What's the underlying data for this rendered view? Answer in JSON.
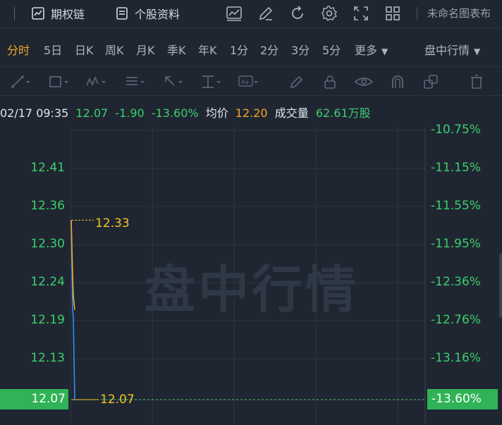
{
  "toolbar": {
    "options_chain_label": "期权链",
    "stock_info_label": "个股资料",
    "chart_name": "未命名图表布"
  },
  "periods": {
    "items": [
      "分时",
      "5日",
      "日K",
      "周K",
      "月K",
      "季K",
      "年K",
      "1分",
      "2分",
      "3分",
      "5分"
    ],
    "active": "分时",
    "more_label": "更多",
    "session_label": "盘中行情"
  },
  "quote": {
    "datetime": "02/17 09:35",
    "price": "12.07",
    "change": "-1.90",
    "change_pct": "-13.60%",
    "avg_label": "均价",
    "avg_price": "12.20",
    "volume_label": "成交量",
    "volume": "62.61万股"
  },
  "watermark": "盘中行情",
  "chart_data": {
    "type": "line",
    "y_ticks_price": [
      "12.41",
      "12.36",
      "12.30",
      "12.24",
      "12.19",
      "12.13",
      "12.07"
    ],
    "y_ticks_pct": [
      "-10.75%",
      "-11.15%",
      "-11.55%",
      "-11.95%",
      "-12.36%",
      "-12.76%",
      "-13.16%",
      "-13.60%"
    ],
    "ylim": [
      12.07,
      12.46
    ],
    "last_price": "12.07",
    "last_pct": "-13.60%",
    "annotation_high": "12.33",
    "annotation_low": "12.07",
    "series": [
      {
        "values": [
          12.33,
          12.26,
          12.2,
          12.19,
          12.07
        ]
      },
      {
        "values": [
          12.33,
          12.29,
          12.25,
          12.22,
          12.2
        ]
      }
    ],
    "colors": {
      "price": "#2f8ef0",
      "avg": "#f5a623",
      "grid": "#2c3542"
    }
  }
}
